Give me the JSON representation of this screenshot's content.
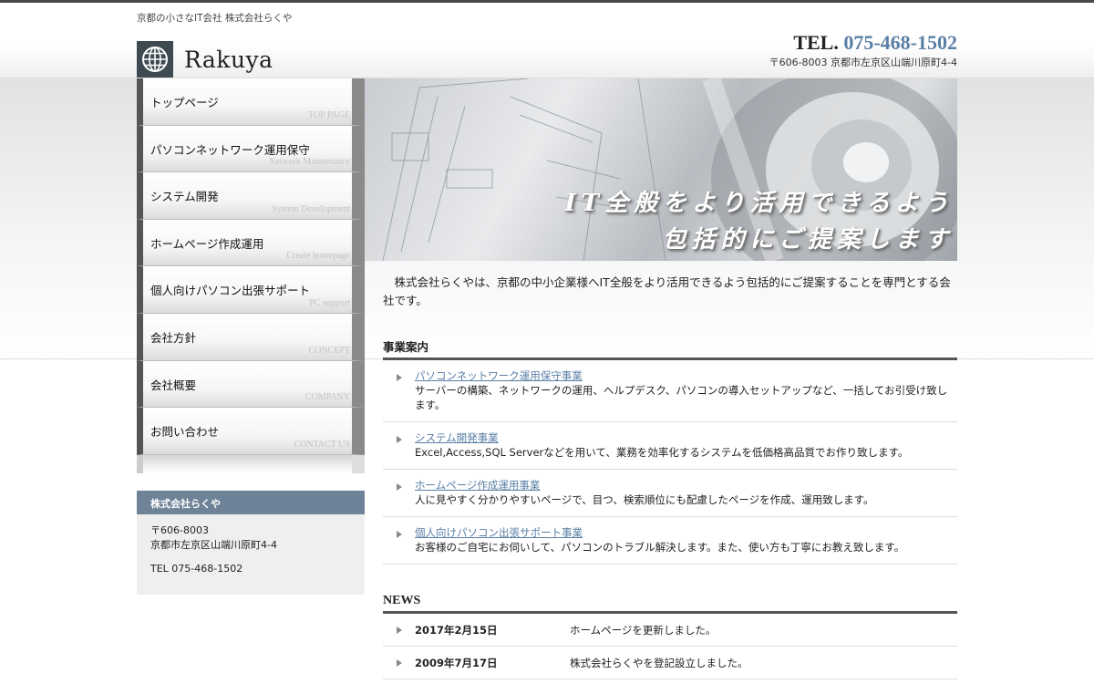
{
  "header": {
    "tagline": "京都の小さなIT会社 株式会社らくや",
    "logo_text": "Rakuya",
    "tel_prefix": "TEL.",
    "tel_number": "075-468-1502",
    "address": "〒606-8003 京都市左京区山端川原町4-4"
  },
  "nav": [
    {
      "jp": "トップページ",
      "en": "TOP PAGE"
    },
    {
      "jp": "パソコンネットワーク運用保守",
      "en": "Network Maintenance"
    },
    {
      "jp": "システム開発",
      "en": "System Development"
    },
    {
      "jp": "ホームページ作成運用",
      "en": "Create homepage"
    },
    {
      "jp": "個人向けパソコン出張サポート",
      "en": "PC support"
    },
    {
      "jp": "会社方針",
      "en": "CONCEPT"
    },
    {
      "jp": "会社概要",
      "en": "COMPANY"
    },
    {
      "jp": "お問い合わせ",
      "en": "CONTACT US"
    }
  ],
  "sidebar": {
    "title": "株式会社らくや",
    "postal": "〒606-8003",
    "address": "京都市左京区山端川原町4-4",
    "tel": "TEL 075-468-1502"
  },
  "hero": {
    "line1": "IT全般をより活用できるよう",
    "line2": "包括的にご提案します"
  },
  "main": {
    "intro": "株式会社らくやは、京都の中小企業様へIT全般をより活用できるよう包括的にご提案することを専門とする会社です。",
    "services_heading": "事業案内",
    "services": [
      {
        "title": "パソコンネットワーク運用保守事業",
        "desc": "サーバーの構築、ネットワークの運用、ヘルプデスク、パソコンの導入セットアップなど、一括してお引受け致します。"
      },
      {
        "title": "システム開発事業",
        "desc": "Excel,Access,SQL Serverなどを用いて、業務を効率化するシステムを低価格高品質でお作り致します。"
      },
      {
        "title": "ホームページ作成運用事業",
        "desc": "人に見やすく分かりやすいページで、目つ、検索順位にも配慮したページを作成、運用致します。"
      },
      {
        "title": "個人向けパソコン出張サポート事業",
        "desc": "お客様のご自宅にお伺いして、パソコンのトラブル解決します。また、使い方も丁寧にお教え致します。"
      }
    ],
    "news_heading": "NEWS",
    "news": [
      {
        "date": "2017年2月15日",
        "text": "ホームページを更新しました。"
      },
      {
        "date": "2009年7月17日",
        "text": "株式会社らくやを登記設立しました。"
      }
    ]
  }
}
